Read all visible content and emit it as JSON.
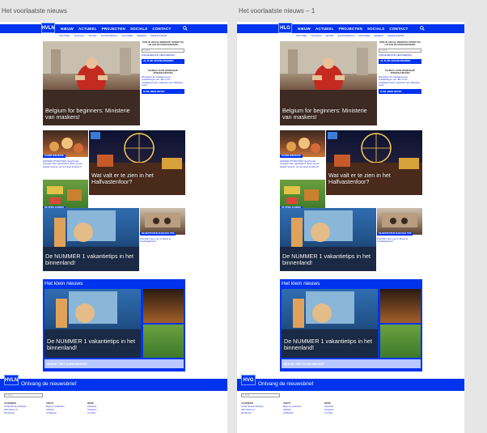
{
  "artboards": [
    {
      "title": "Het voorlaatste nieuws",
      "logo": "HVLN",
      "footer_logo": "HVLN"
    },
    {
      "title": "Het voorlaatste nieuws – 1",
      "logo": "HLG",
      "footer_logo": "HVG"
    }
  ],
  "nav": {
    "items": [
      "NIEUW",
      "ACTUEEL",
      "PROJECTEN",
      "SOCIALS",
      "CONTACT"
    ],
    "search_icon": "search-icon",
    "subnav": [
      "POLITIEK",
      "SOCIAAL",
      "SPORT",
      "ECONOMISCH",
      "RACISME",
      "WEREW",
      "WEGSCHROB"
    ]
  },
  "sidebar": {
    "title": "KOM JE GRAAG WERKEN? WORDT NU LID VAN DE KERKGENOEMS!",
    "input_placeholder": "E-MAIL",
    "link": "DOEGENERATIE KERKWERKEN",
    "button1": "JA, IK WIL EEN NIEUWSBRIEF",
    "box_title": "SCHRIJF JOUW WORKSHOP SPREEKUURSTER",
    "box_text": "Wat doelen de vrijwilligers jouw ontwikkelingen van: 'Elk 4.4 de vrijwilligersrooster, geleerden aan 'Wisseling ervan'",
    "button2": "IK WIL MEER WETEN"
  },
  "stories": {
    "hero_headline": "Belgium for beginners: Ministerie van maskers!",
    "tag1": "KLEINE NIEUWSJE",
    "small_text1": "LEKKER ATTRACTIEF!\nGeschonde vleugels?\nEen aanbieden!\nZitten het de laatste recente, op het Hotel kinderen?",
    "tag2": "DE SPEELGARENS",
    "small_text2": "Met kinderen de jeugdigste 'Kwantijdpoppen'? is nu ook ambitieuzelte met wedijger",
    "fair_headline": "Wat valt er te zien in het Halfvastenfoor?",
    "vacation_headline": "De NUMMER 1 vakantietips in het binnenland!",
    "tag3": "DE BESTUUR IN ELKE DAG TOE",
    "small_text3": "POLICE? Hoe men in Street te Vreelbaahnties?",
    "klein_title": "Het klein nieuws",
    "klein_headline": "De NUMMER 1 vakantietips in het binnenland!",
    "klein_bar": "BEKIJK \"HET KLEIN NIEUWS\""
  },
  "footer": {
    "title": "Ontvang de nieuwsbrief",
    "input_placeholder": "E-MAIL",
    "columns": [
      {
        "heading": "ALGEMEEN",
        "links": [
          "Terwijl Nieuwe dinbrede",
          "Alles Nieuw nu",
          "Workshops"
        ]
      },
      {
        "heading": "ABOUT",
        "links": [
          "Begin en producten",
          "Voltheek",
          "Oudheeten"
        ]
      },
      {
        "heading": "MORE",
        "links": [
          "Facebook",
          "Instagram",
          "YouTube"
        ]
      }
    ]
  },
  "colors": {
    "brand_blue": "#0033ee",
    "light_blue": "#b9c8ff",
    "link_blue": "#2233cc",
    "canvas": "#e6e6e6"
  }
}
